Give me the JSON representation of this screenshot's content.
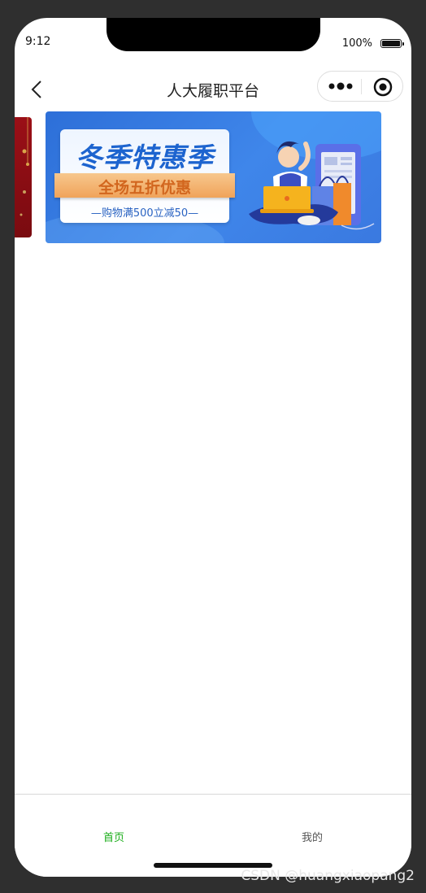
{
  "status": {
    "time": "9:12",
    "battery": "100%"
  },
  "nav": {
    "title": "人大履职平台"
  },
  "banner": {
    "title": "冬季特惠季",
    "subtitle": "全场五折优惠",
    "note": "—购物满500立减50—"
  },
  "tabs": [
    {
      "label": "首页",
      "active": true,
      "color": "#1aad19"
    },
    {
      "label": "我的",
      "active": false,
      "color": "#555555"
    }
  ],
  "watermark": "CSDN @huangxiaopang2"
}
